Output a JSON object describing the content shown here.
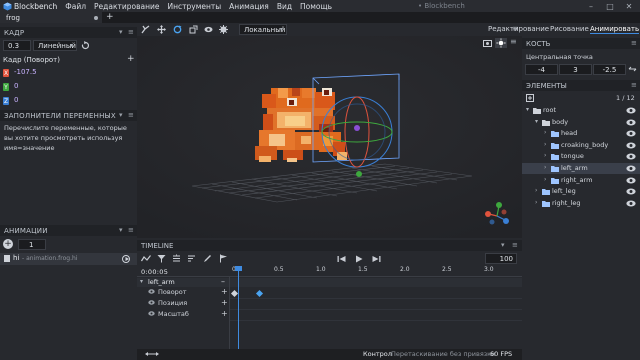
{
  "app": {
    "name": "Blockbench",
    "menu": [
      "Файл",
      "Редактирование",
      "Инструменты",
      "Анимация",
      "Вид",
      "Помощь"
    ],
    "window_title": "• Blockbench",
    "tab": "frog"
  },
  "keyframe_panel": {
    "title": "КАДР",
    "time_value": "0.3",
    "interpolation": "Линейный",
    "subtitle": "Кадр (Поворот)",
    "axes": [
      {
        "axis": "X",
        "value": "-107.5",
        "color": "#e0533d"
      },
      {
        "axis": "Y",
        "value": "0",
        "color": "#3ea83e"
      },
      {
        "axis": "Z",
        "value": "0",
        "color": "#3a7fd5"
      }
    ]
  },
  "variables_panel": {
    "title": "ЗАПОЛНИТЕЛИ ПЕРЕМЕННЫХ",
    "description": "Перечислите переменные, которые вы хотите просмотреть используя имя=значение"
  },
  "animations_panel": {
    "title": "АНИМАЦИИ",
    "count": "1",
    "item": "hi",
    "item_file": "- animation.frog.hi"
  },
  "toolbar": {
    "space_mode": "Локальный"
  },
  "workspace_tabs": [
    "Редактирование",
    "Рисование",
    "Анимировать"
  ],
  "bone_panel": {
    "title": "КОСТЬ",
    "pivot_label": "Центральная точка",
    "pivot": [
      "-4",
      "3",
      "-2.5"
    ]
  },
  "elements_panel": {
    "title": "ЭЛЕМЕНТЫ",
    "counter": "1 / 12",
    "tree": [
      {
        "label": "root",
        "type": "group",
        "depth": 0,
        "open": true
      },
      {
        "label": "body",
        "type": "group",
        "depth": 1,
        "open": true
      },
      {
        "label": "head",
        "type": "group",
        "depth": 2,
        "open": false
      },
      {
        "label": "croaking_body",
        "type": "group",
        "depth": 2,
        "open": false
      },
      {
        "label": "tongue",
        "type": "group",
        "depth": 2,
        "open": false
      },
      {
        "label": "left_arm",
        "type": "group",
        "depth": 2,
        "open": false,
        "selected": true
      },
      {
        "label": "right_arm",
        "type": "group",
        "depth": 2,
        "open": false
      },
      {
        "label": "left_leg",
        "type": "group",
        "depth": 1,
        "open": false
      },
      {
        "label": "right_leg",
        "type": "group",
        "depth": 1,
        "open": false
      }
    ]
  },
  "timeline": {
    "title": "TIMELINE",
    "time_display": "0:00:05",
    "playback_speed": "100",
    "ruler": [
      "0.0",
      "0.5",
      "1.0",
      "1.5",
      "2.0",
      "2.5",
      "3.0"
    ],
    "bone": "left_arm",
    "channels": [
      "Поворот",
      "Позиция",
      "Масштаб"
    ],
    "rotation_keyframes_seconds": [
      0.0,
      0.3
    ],
    "playhead_seconds": 0.05
  },
  "statusbar": {
    "mode": "Контрол",
    "snap": "Перетаскивание без привязки",
    "fps": "60 FPS"
  }
}
